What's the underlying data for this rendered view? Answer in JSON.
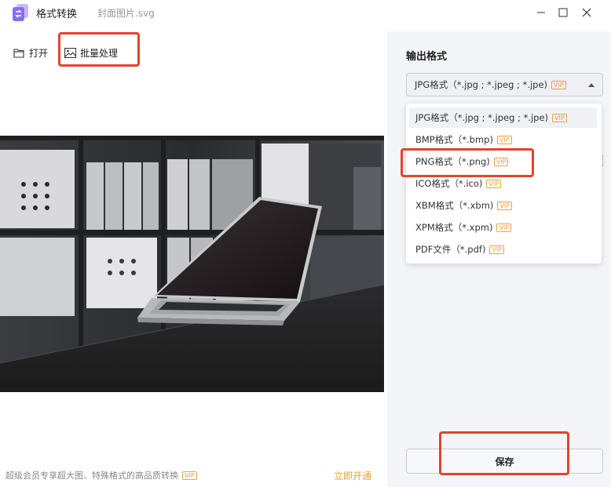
{
  "titlebar": {
    "app_title": "格式转换",
    "file_name": "封面图片.svg"
  },
  "toolbar": {
    "open_label": "打开",
    "batch_label": "批量处理"
  },
  "footer": {
    "note": "超级会员专享超大图、特殊格式的高品质转换",
    "vip": "VIP",
    "open_link": "立即开通"
  },
  "output": {
    "heading": "输出格式",
    "selected": "JPG格式（*.jpg ; *.jpeg ; *.jpe)",
    "vip": "VIP",
    "options": [
      "JPG格式（*.jpg ; *.jpeg ; *.jpe)",
      "BMP格式（*.bmp)",
      "PNG格式（*.png)",
      "ICO格式（*.ico)",
      "XBM格式（*.xbm)",
      "XPM格式（*.xpm)",
      "PDF文件（*.pdf)"
    ]
  },
  "save_label": "保存",
  "colors": {
    "accent_orange": "#e8a23a",
    "highlight_red": "#e2432e",
    "app_icon": "#8a6de9"
  }
}
